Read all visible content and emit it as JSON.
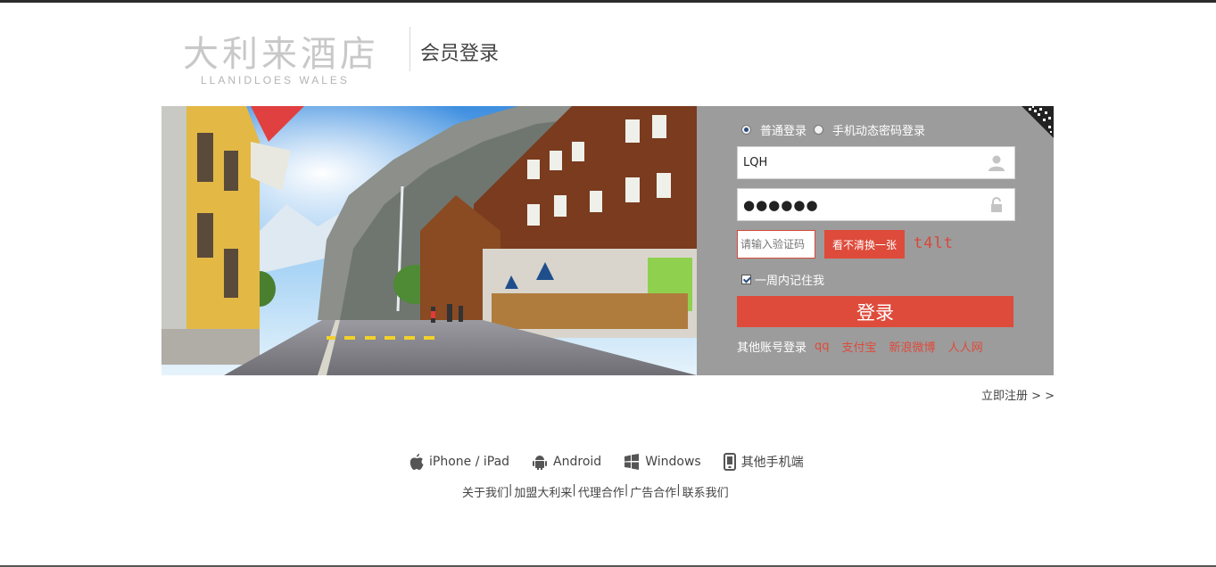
{
  "header": {
    "logo_cn": "大利来酒店",
    "logo_en": "LLANIDLOES WALES",
    "title": "会员登录"
  },
  "login": {
    "modes": [
      "普通登录",
      "手机动态密码登录"
    ],
    "selected_mode": "普通登录",
    "username": "LQH",
    "password_mask": "●●●●●●",
    "captcha_placeholder": "请输入验证码",
    "captcha_refresh_label": "看不清换一张",
    "captcha_code": "t4lt",
    "remember_label": "一周内记住我",
    "remember_checked": true,
    "submit_label": "登录",
    "other_login_label": "其他账号登录",
    "other_login_links": [
      "qq",
      "支付宝",
      "新浪微博",
      "人人网"
    ]
  },
  "register_link": "立即注册 > >",
  "apps": [
    {
      "label": "iPhone / iPad",
      "icon": "apple-icon"
    },
    {
      "label": "Android",
      "icon": "android-icon"
    },
    {
      "label": "Windows",
      "icon": "windows-icon"
    },
    {
      "label": "其他手机端",
      "icon": "mobile-phone-icon"
    }
  ],
  "footer_links": [
    "关于我们",
    "加盟大利来",
    "代理合作",
    "广告合作",
    "联系我们"
  ],
  "colors": {
    "accent": "#de4b3b",
    "panel_bg": "#9c9c9c",
    "topbar": "#2b2b2b"
  }
}
